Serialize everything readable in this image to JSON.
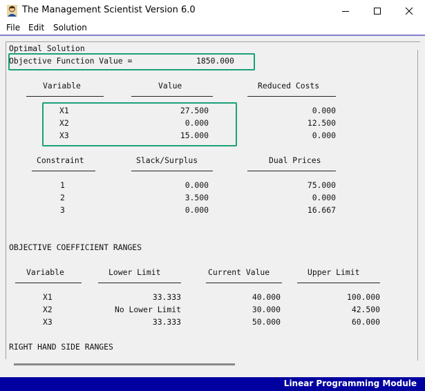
{
  "window": {
    "title": "The Management Scientist Version 6.0",
    "icon": "man-portrait-icon"
  },
  "menu": [
    "File",
    "Edit",
    "Solution"
  ],
  "report": {
    "heading": "Optimal Solution",
    "objective": {
      "label": "Objective Function Value =",
      "value": "1850.000"
    },
    "variables": {
      "headers": [
        "Variable",
        "Value",
        "Reduced Costs"
      ],
      "rows": [
        [
          "X1",
          "27.500",
          "0.000"
        ],
        [
          "X2",
          "0.000",
          "12.500"
        ],
        [
          "X3",
          "15.000",
          "0.000"
        ]
      ]
    },
    "constraints": {
      "headers": [
        "Constraint",
        "Slack/Surplus",
        "Dual Prices"
      ],
      "rows": [
        [
          "1",
          "0.000",
          "75.000"
        ],
        [
          "2",
          "3.500",
          "0.000"
        ],
        [
          "3",
          "0.000",
          "16.667"
        ]
      ]
    },
    "objective_ranges": {
      "title": "OBJECTIVE COEFFICIENT RANGES",
      "headers": [
        "Variable",
        "Lower Limit",
        "Current Value",
        "Upper Limit"
      ],
      "rows": [
        [
          "X1",
          "33.333",
          "40.000",
          "100.000"
        ],
        [
          "X2",
          "No Lower Limit",
          "30.000",
          "42.500"
        ],
        [
          "X3",
          "33.333",
          "50.000",
          "60.000"
        ]
      ]
    },
    "rhs_title": "RIGHT HAND SIDE RANGES"
  },
  "status": "Linear Programming Module",
  "colors": {
    "highlight": "#1aa078",
    "statusbar": "#0000a0"
  }
}
